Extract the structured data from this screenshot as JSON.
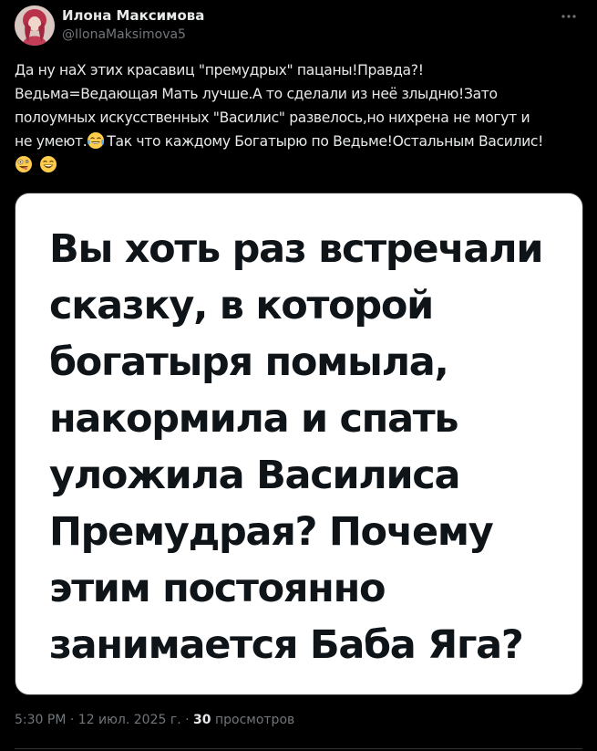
{
  "author": {
    "display_name": "Илона Максимова",
    "handle": "@IlonaMaksimova5"
  },
  "tweet": {
    "text_lines": [
      "Да ну наХ этих красавиц \"премудрых\" пацаны!Правда?!",
      "Ведьма=Ведающая Мать лучше.А то сделали из неё злыдню!Зато",
      "полоумных искусственных \"Василис\" развелось,но нихрена не могут и",
      "не умеют.",
      "Так что каждому Богатырю по Ведьме!Остальным Василис!"
    ],
    "emojis": [
      "tears-of-joy-emoji",
      "zany-face-emoji",
      "grinning-face-emoji"
    ]
  },
  "media": {
    "image_text_lines": [
      "Вы хоть раз встречали",
      "сказку, в которой",
      "богатыря помыла,",
      "накормила и спать",
      "уложила Василиса",
      "Премудрая? Почему",
      "этим постоянно",
      "занимается Баба Яга?"
    ]
  },
  "meta": {
    "time": "5:30 PM",
    "separator": "·",
    "date": "12 июл. 2025 г.",
    "views_count": "30",
    "views_label": "просмотров"
  },
  "colors": {
    "background": "#000000",
    "text_primary": "#e7e9ea",
    "text_secondary": "#71767b",
    "border": "#2f3336",
    "image_background": "#ffffff",
    "image_text": "#0f1419"
  }
}
